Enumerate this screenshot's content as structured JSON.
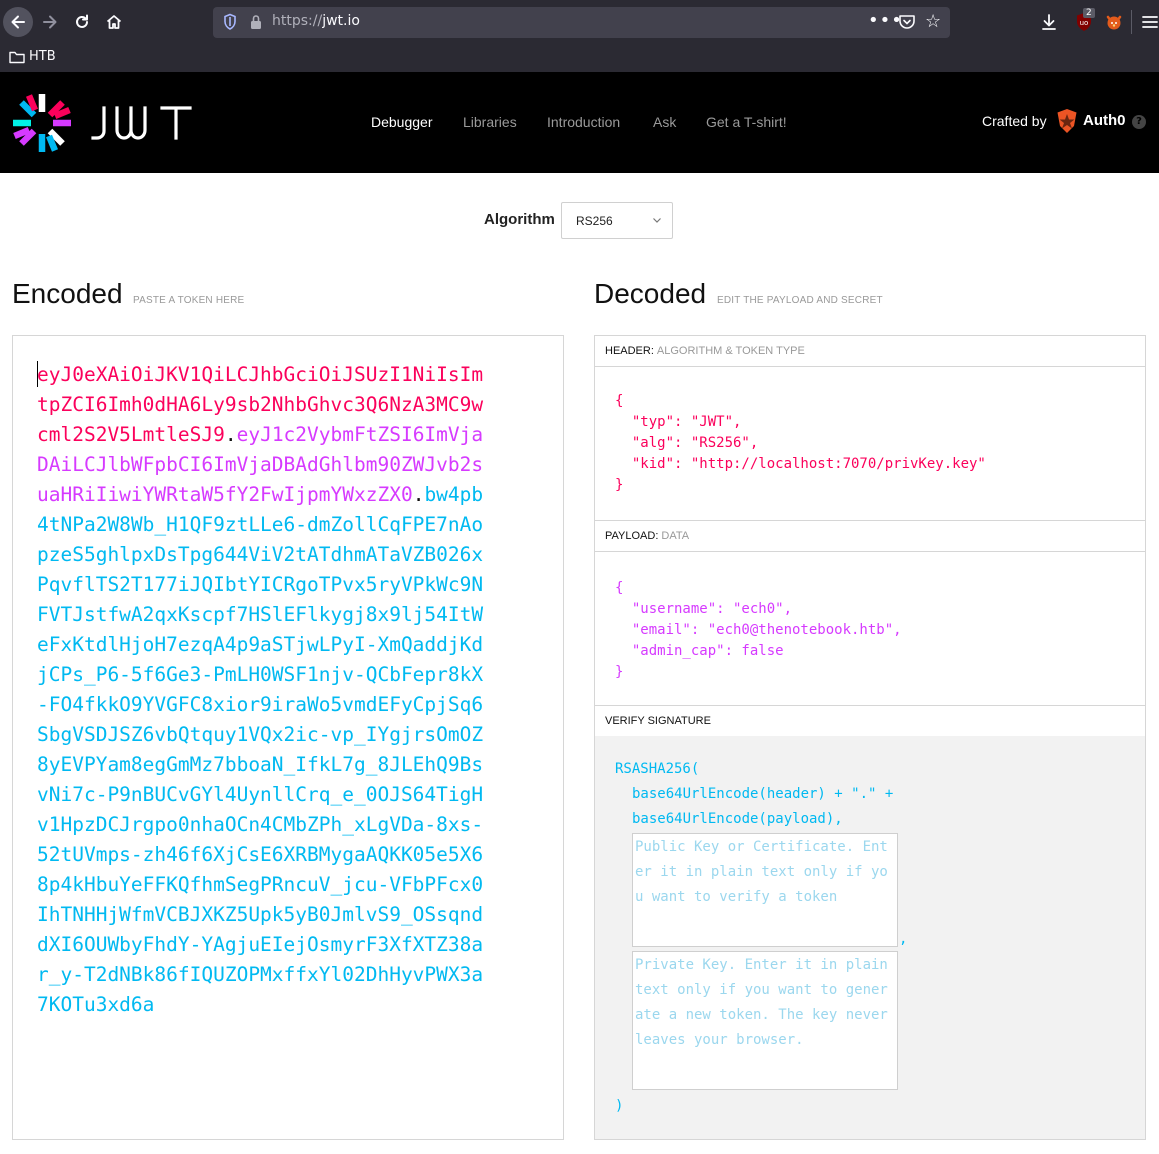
{
  "browser": {
    "url_scheme": "https://",
    "url_host": "jwt.io",
    "more_label": "•••",
    "ublock_badge": "2",
    "bookmark_folder": "HTB"
  },
  "header": {
    "logo_text": "JWT",
    "nav": [
      "Debugger",
      "Libraries",
      "Introduction",
      "Ask",
      "Get a T-shirt!"
    ],
    "crafted_by": "Crafted by",
    "auth0": "Auth0",
    "help": "?"
  },
  "algorithm": {
    "label": "Algorithm",
    "value": "RS256"
  },
  "encoded": {
    "title": "Encoded",
    "subtitle": "PASTE A TOKEN HERE",
    "token_header": "eyJ0eXAiOiJKV1QiLCJhbGciOiJSUzI1NiIsImtpZCI6Imh0dHA6Ly9sb2NhbGhvc3Q6NzA3MC9wcml2S2V5LmtleSJ9",
    "token_payload": "eyJ1c2VybmFtZSI6ImVjaDAiLCJlbWFpbCI6ImVjaDBAdGhlbm90ZWJvb2suaHRiIiwiYWRtaW5fY2FwIjpmYWxzZX0",
    "token_signature": "bw4pb4tNPa2W8Wb_H1QF9ztLLe6-dmZollCqFPE7nAopzeS5ghlpxDsTpg644ViV2tATdhmATaVZB026xPqvflTS2T177iJQIbtYICRgoTPvx5ryVPkWc9NFVTJstfwA2qxKscpf7HSlEFlkygj8x9lj54ItWeFxKtdlHjoH7ezqA4p9aSTjwLPyI-XmQaddjKdjCPs_P6-5f6Ge3-PmLH0WSF1njv-QCbFepr8kX-FO4fkkO9YVGFC8xior9iraWo5vmdEFyCpjSq6SbgVSDJSZ6vbQtquy1VQx2ic-vp_IYgjrsOmOZ8yEVPYam8egGmMz7bboaN_IfkL7g_8JLEhQ9BsvNi7c-P9nBUCvGYl4UynllCrq_e_0OJS64TigHv1HpzDCJrgpo0nhaOCn4CMbZPh_xLgVDa-8xs-52tUVmps-zh46f6XjCsE6XRBMygaAQKK05e5X68p4kHbuYeFFKQfhmSegPRncuV_jcu-VFbPFcx0IhTNHHjWfmVCBJXKZ5Upk5yB0JmlvS9_OSsqnddXI6OUWbyFhdY-YAgjuEIejOsmyrF3XfXTZ38ar_y-T2dNBk86fIQUZOPMxffxYl02DhHyvPWX3a7KOTu3xd6a"
  },
  "decoded": {
    "title": "Decoded",
    "subtitle": "EDIT THE PAYLOAD AND SECRET",
    "header_section": {
      "label": "HEADER:",
      "sub": "ALGORITHM & TOKEN TYPE"
    },
    "header_json": [
      "{",
      "  \"typ\": \"JWT\",",
      "  \"alg\": \"RS256\",",
      "  \"kid\": \"http://localhost:7070/privKey.key\"",
      "}"
    ],
    "payload_section": {
      "label": "PAYLOAD:",
      "sub": "DATA"
    },
    "payload_json": [
      "{",
      "  \"username\": \"ech0\",",
      "  \"email\": \"ech0@thenotebook.htb\",",
      "  \"admin_cap\": false",
      "}"
    ],
    "verify_section": {
      "label": "VERIFY SIGNATURE"
    },
    "verify": {
      "fn": "RSASHA256(",
      "line1": "base64UrlEncode(header) + \".\" +",
      "line2": "base64UrlEncode(payload),",
      "public_key_placeholder": "Public Key or Certificate. Enter it in plain text only if you want to verify a token",
      "comma": ",",
      "private_key_placeholder": "Private Key. Enter it in plain text only if you want to generate a new token. The key never leaves your browser.",
      "close": ")"
    }
  },
  "colors": {
    "token_header": "#fb015b",
    "token_payload": "#d63aff",
    "token_signature": "#00b9f1"
  }
}
